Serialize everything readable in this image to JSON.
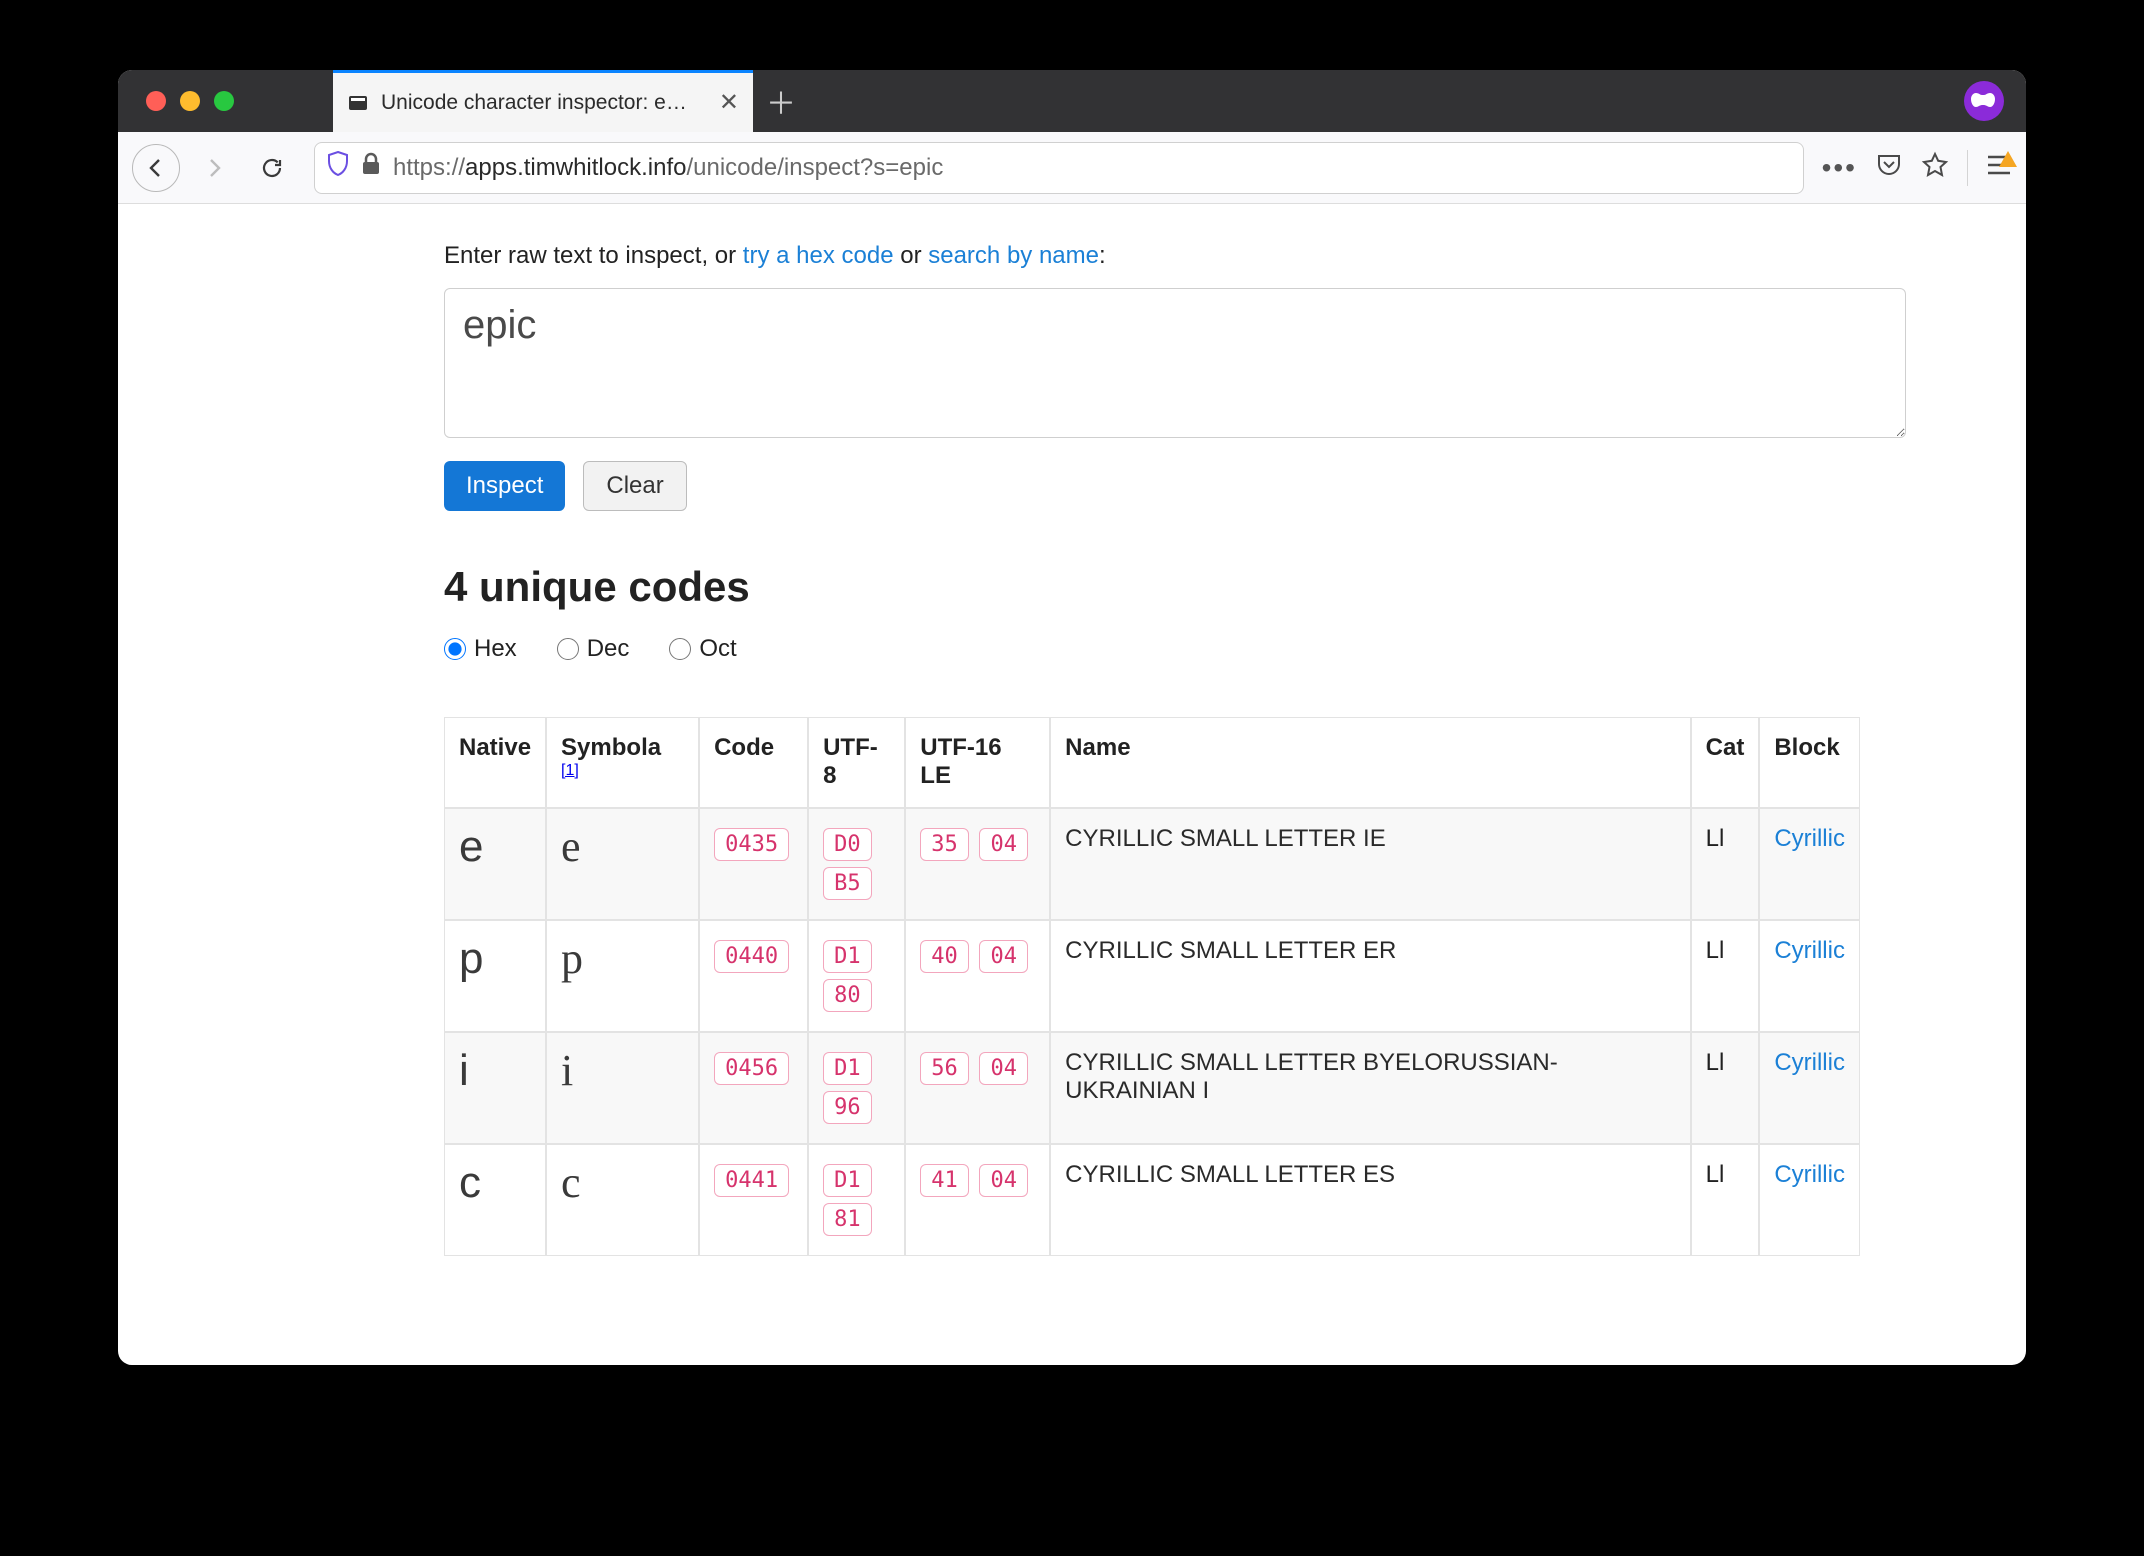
{
  "browser": {
    "tab_title": "Unicode character inspector: e…",
    "url_display_prefix": "https://",
    "url_display_host": "apps.timwhitlock.info",
    "url_display_path": "/unicode/inspect?s=epic"
  },
  "page": {
    "intro_prefix": "Enter raw text to inspect, or ",
    "intro_link_hex": "try a hex code",
    "intro_mid": " or ",
    "intro_link_name": "search by name",
    "intro_suffix": ":",
    "textarea_value": "epic",
    "inspect_label": "Inspect",
    "clear_label": "Clear",
    "heading": "4 unique codes",
    "radix": {
      "hex": "Hex",
      "dec": "Dec",
      "oct": "Oct",
      "selected": "hex"
    },
    "columns": {
      "native": "Native",
      "symbola": "Symbola",
      "symbola_ref": "[1]",
      "code": "Code",
      "utf8": "UTF-8",
      "utf16": "UTF-16 LE",
      "name": "Name",
      "cat": "Cat",
      "block": "Block"
    },
    "rows": [
      {
        "native": "е",
        "symbola": "е",
        "code": "0435",
        "utf8": [
          "D0",
          "B5"
        ],
        "utf16": [
          "35",
          "04"
        ],
        "name": "CYRILLIC SMALL LETTER IE",
        "cat": "Ll",
        "block": "Cyrillic"
      },
      {
        "native": "р",
        "symbola": "р",
        "code": "0440",
        "utf8": [
          "D1",
          "80"
        ],
        "utf16": [
          "40",
          "04"
        ],
        "name": "CYRILLIC SMALL LETTER ER",
        "cat": "Ll",
        "block": "Cyrillic"
      },
      {
        "native": "і",
        "symbola": "і",
        "code": "0456",
        "utf8": [
          "D1",
          "96"
        ],
        "utf16": [
          "56",
          "04"
        ],
        "name": "CYRILLIC SMALL LETTER BYELORUSSIAN-UKRAINIAN I",
        "cat": "Ll",
        "block": "Cyrillic"
      },
      {
        "native": "с",
        "symbola": "с",
        "code": "0441",
        "utf8": [
          "D1",
          "81"
        ],
        "utf16": [
          "41",
          "04"
        ],
        "name": "CYRILLIC SMALL LETTER ES",
        "cat": "Ll",
        "block": "Cyrillic"
      }
    ]
  }
}
